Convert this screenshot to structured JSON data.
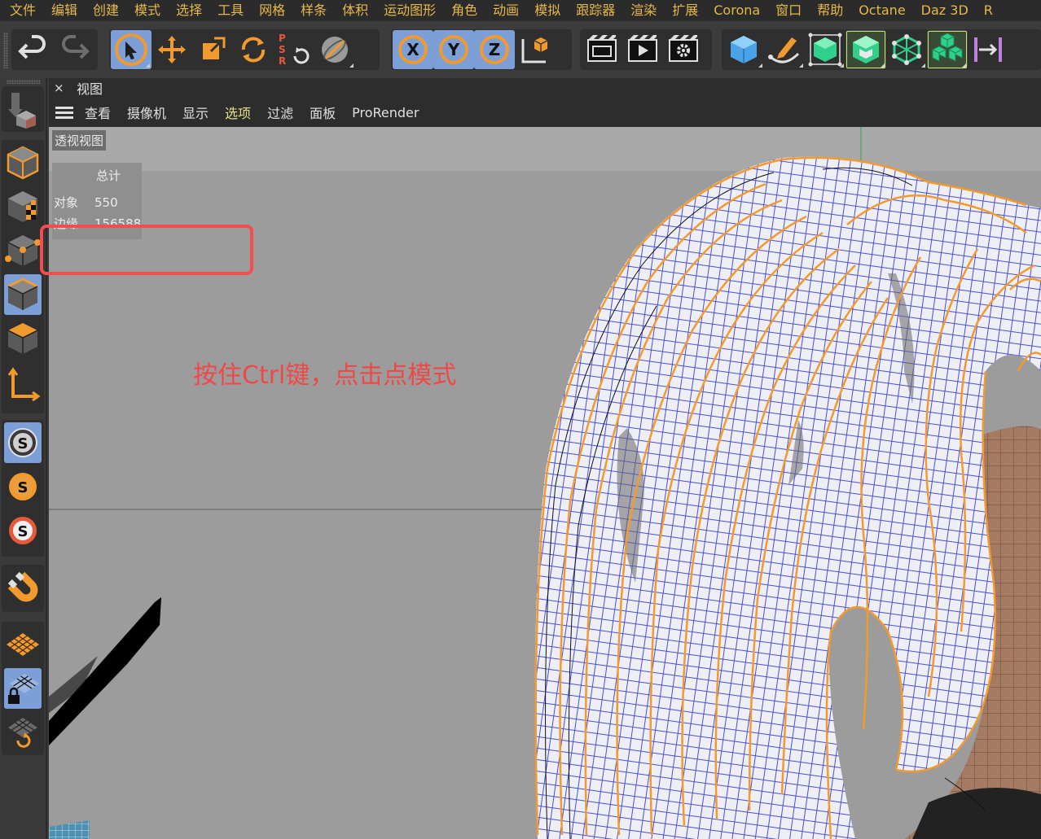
{
  "menu_bar": {
    "items": [
      "文件",
      "编辑",
      "创建",
      "模式",
      "选择",
      "工具",
      "网格",
      "样条",
      "体积",
      "运动图形",
      "角色",
      "动画",
      "模拟",
      "跟踪器",
      "渲染",
      "扩展",
      "Corona",
      "窗口",
      "帮助",
      "Octane",
      "Daz 3D",
      "R"
    ]
  },
  "toolbar": {
    "groups": [
      [
        "undo-icon",
        "redo-icon"
      ],
      [
        "live-selection-icon",
        "move-icon",
        "scale-icon",
        "rotate-icon",
        "psr-reset-icon",
        "coordinate-system-icon"
      ],
      [
        "x-axis-lock-icon",
        "y-axis-lock-icon",
        "z-axis-lock-icon",
        "world-coordinates-icon"
      ],
      [
        "render-region-icon",
        "render-view-icon",
        "render-settings-icon"
      ],
      [
        "cube-icon",
        "pen-icon",
        "subdivision-icon",
        "extrude-icon",
        "mograph-cloner-icon",
        "voxel-icon",
        "symmetry-icon"
      ]
    ]
  },
  "palette": {
    "tools": [
      "make-editable-icon",
      "model-mode-icon",
      "texture-mode-icon",
      "point-mode-icon",
      "edge-mode-icon",
      "polygon-mode-icon",
      "axis-mode-icon",
      "snap-icon",
      "snap-settings-icon",
      "solo-icon",
      "magnet-icon",
      "workplane-icon",
      "workplane-lock-icon",
      "workplane-align-icon"
    ]
  },
  "viewport": {
    "close_glyph": "×",
    "title": "视图",
    "menu": [
      "查看",
      "摄像机",
      "显示",
      "选项",
      "过滤",
      "面板",
      "ProRender"
    ],
    "highlighted_menu": "选项",
    "camera_label": "透视视图",
    "hud": {
      "title": "总计",
      "rows": [
        {
          "label": "对象",
          "value": "550"
        },
        {
          "label": "边缘",
          "value": "156588"
        }
      ]
    }
  },
  "annotation": {
    "text": "按住Ctrl键，点击点模式",
    "color": "#f04848"
  },
  "colors": {
    "menu_text": "#e6b84a",
    "accent_orange": "#f39a2e",
    "active_blue": "#7d9fd8",
    "wire_blue": "#4a4fd0"
  }
}
